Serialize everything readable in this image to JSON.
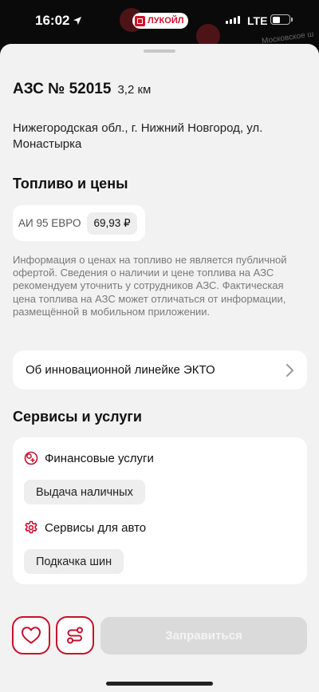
{
  "status_bar": {
    "time": "16:02",
    "brand": "ЛУКОЙЛ",
    "network": "LTE",
    "battery_level": 0.45
  },
  "map": {
    "street_label": "Московское ш"
  },
  "station": {
    "title": "АЗС № 52015",
    "distance": "3,2 км",
    "address": "Нижегородская обл., г. Нижний Новгород, ул. Монастырка"
  },
  "fuel": {
    "section_title": "Топливо и цены",
    "items": [
      {
        "name": "АИ 95 ЕВРО",
        "price": "69,93 ₽"
      }
    ],
    "disclaimer": "Информация о ценах на топливо не является публичной офертой. Сведения о наличии и цене топлива на АЗС рекомендуем уточнить у сотрудников АЗС. Фактическая цена топлива на АЗС может отличаться от информации, размещённой в мобильном приложении."
  },
  "ekto": {
    "label": "Об инновационной линейке ЭКТО"
  },
  "services": {
    "section_title": "Сервисы и услуги",
    "groups": [
      {
        "title": "Финансовые услуги",
        "icon": "finance-icon",
        "items": [
          "Выдача наличных"
        ]
      },
      {
        "title": "Сервисы для авто",
        "icon": "gear-icon",
        "items": [
          "Подкачка шин"
        ]
      }
    ]
  },
  "actions": {
    "favorite_icon": "heart-icon",
    "route_icon": "route-icon",
    "refuel_label": "Заправиться"
  },
  "colors": {
    "brand_red": "#d0112b",
    "sheet_bg": "#f2f2f2",
    "card_bg": "#ffffff",
    "chip_bg": "#eeeeee",
    "disabled_button": "#dadada"
  }
}
